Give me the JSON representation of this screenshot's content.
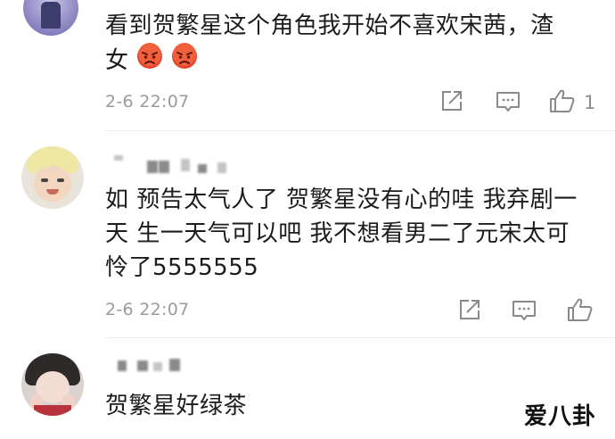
{
  "comments": [
    {
      "text_line1": "看到贺繁星这个角色我开始不喜欢宋茜，渣",
      "text_line2": "女",
      "emojis": [
        "angry-face-icon",
        "angry-face-icon"
      ],
      "timestamp": "2-6 22:07",
      "like_count": "1"
    },
    {
      "text_line1": "如 预告太气人了 贺繁星没有心的哇 我弃剧一",
      "text_line2": "天 生一天气可以吧 我不想看男二了元宋太可",
      "text_line3": "怜了5555555",
      "timestamp": "2-6 22:07"
    },
    {
      "text_line1": "贺繁星好绿茶"
    }
  ],
  "watermark": "爱八卦",
  "colors": {
    "text": "#1c1c1c",
    "meta": "#9a9a9a",
    "icon": "#8a8a8a",
    "divider": "#ececec",
    "emoji_red": "#e4452b"
  }
}
